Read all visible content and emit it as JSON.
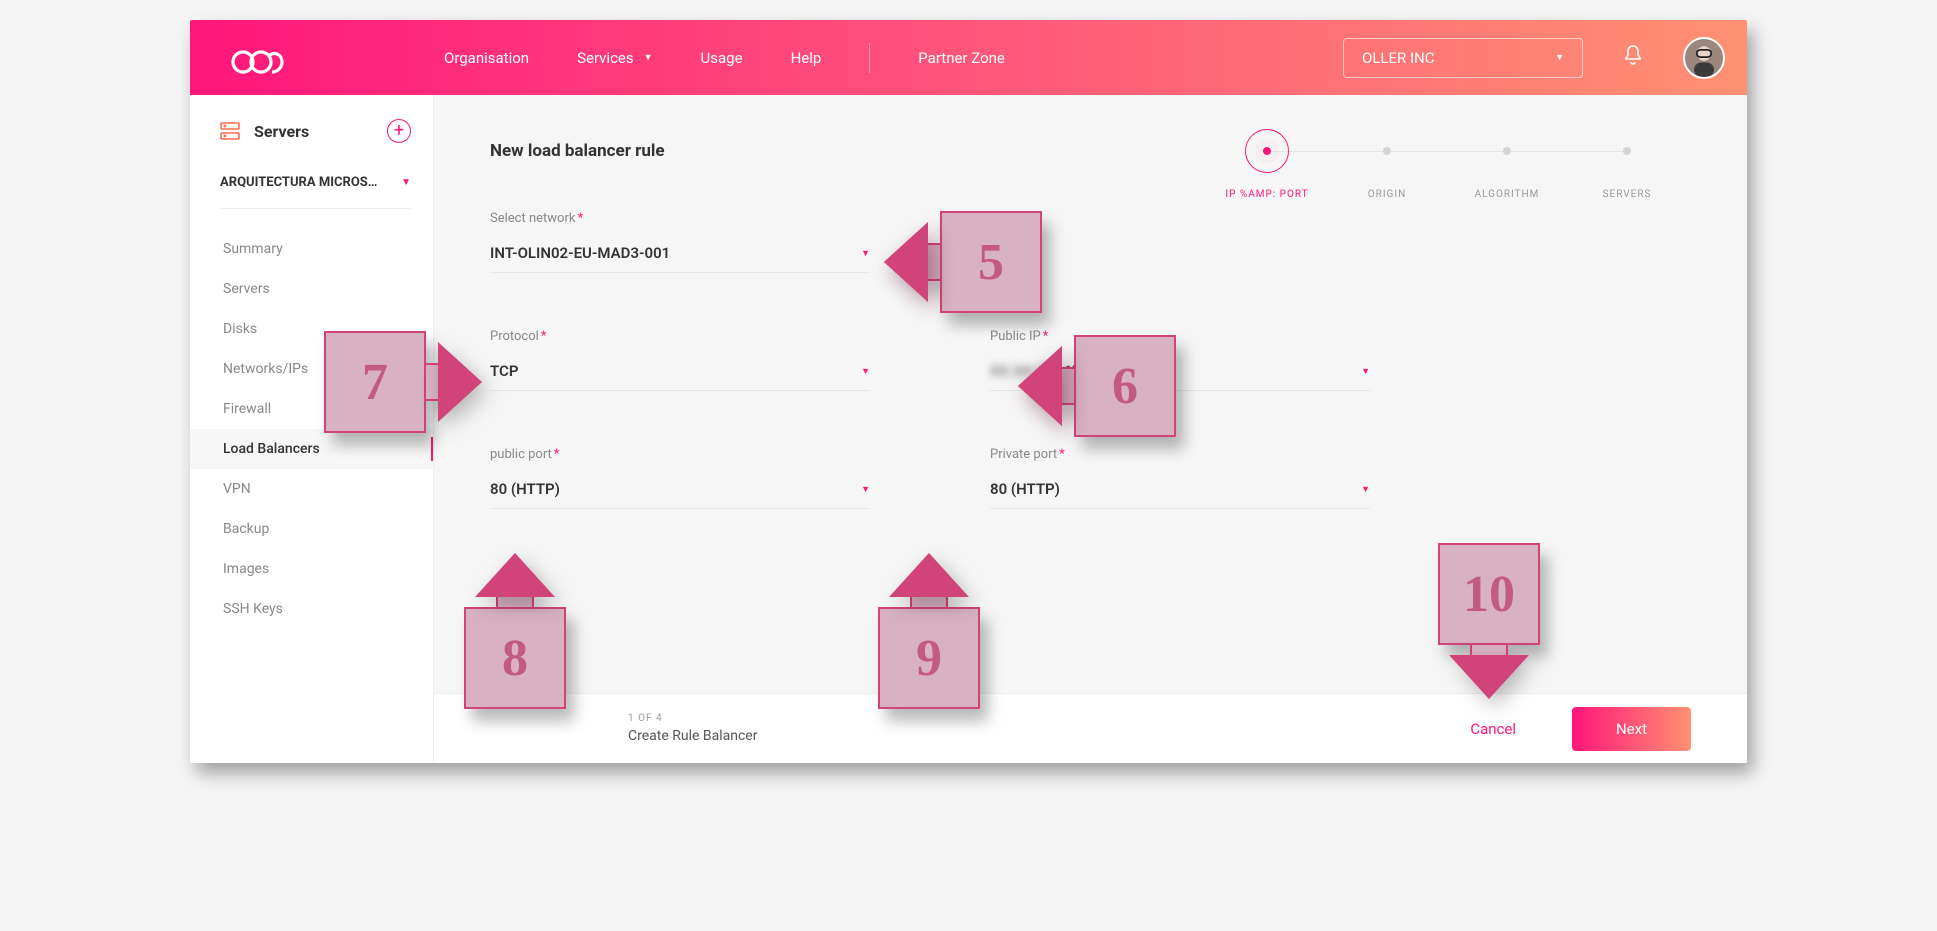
{
  "header": {
    "nav": {
      "organisation": "Organisation",
      "services": "Services",
      "usage": "Usage",
      "help": "Help",
      "partner": "Partner Zone"
    },
    "org_select": "OLLER INC"
  },
  "sidebar": {
    "title": "Servers",
    "project": "ARQUITECTURA MICROS…",
    "items": [
      {
        "label": "Summary"
      },
      {
        "label": "Servers"
      },
      {
        "label": "Disks"
      },
      {
        "label": "Networks/IPs"
      },
      {
        "label": "Firewall"
      },
      {
        "label": "Load Balancers"
      },
      {
        "label": "VPN"
      },
      {
        "label": "Backup"
      },
      {
        "label": "Images"
      },
      {
        "label": "SSH Keys"
      }
    ],
    "active_index": 5
  },
  "stepper": {
    "steps": [
      {
        "label": "IP %AMP: PORT"
      },
      {
        "label": "ORIGIN"
      },
      {
        "label": "ALGORITHM"
      },
      {
        "label": "SERVERS"
      }
    ],
    "active_index": 0
  },
  "page": {
    "title": "New load balancer rule",
    "fields": {
      "network": {
        "label": "Select network",
        "value": "INT-OLIN02-EU-MAD3-001"
      },
      "protocol": {
        "label": "Protocol",
        "value": "TCP"
      },
      "public_ip": {
        "label": "Public IP",
        "value_suffix": ".17",
        "value_hidden": "XX.XX.XX"
      },
      "public_port": {
        "label": "public port",
        "value": "80 (HTTP)"
      },
      "private_port": {
        "label": "Private port",
        "value": "80 (HTTP)"
      }
    }
  },
  "footer": {
    "step_count": "1 OF 4",
    "subtitle": "Create Rule Balancer",
    "cancel": "Cancel",
    "next": "Next"
  },
  "callouts": {
    "c5": "5",
    "c6": "6",
    "c7": "7",
    "c8": "8",
    "c9": "9",
    "c10": "10"
  }
}
